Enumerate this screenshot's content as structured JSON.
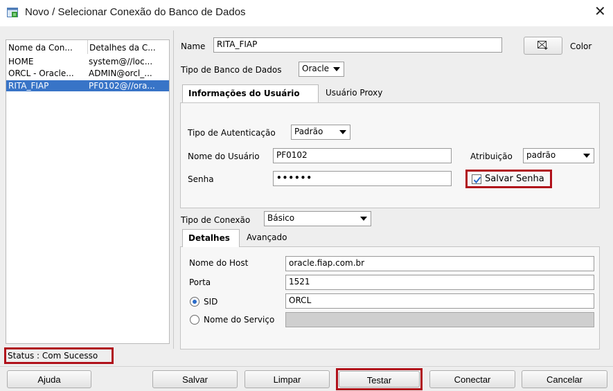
{
  "window": {
    "title": "Novo / Selecionar Conexão do Banco de Dados",
    "close_glyph": "✕"
  },
  "connections": {
    "columns": [
      "Nome da Con...",
      "Detalhes da C..."
    ],
    "rows": [
      {
        "name": "HOME",
        "details": "system@//loc...",
        "selected": false
      },
      {
        "name": "ORCL - Oracle...",
        "details": "ADMIN@orcl_...",
        "selected": false
      },
      {
        "name": "RITA_FIAP",
        "details": "PF0102@//ora...",
        "selected": true
      }
    ]
  },
  "form": {
    "name_label": "Name",
    "name_value": "RITA_FIAP",
    "color_label": "Color",
    "db_type_label": "Tipo de Banco de Dados",
    "db_type_value": "Oracle",
    "user_tabs": [
      "Informações do Usuário",
      "Usuário Proxy"
    ],
    "auth_type_label": "Tipo de Autenticação",
    "auth_type_value": "Padrão",
    "username_label": "Nome do Usuário",
    "username_value": "PF0102",
    "role_label": "Atribuição",
    "role_value": "padrão",
    "password_label": "Senha",
    "password_value": "••••••",
    "save_password_label": "Salvar Senha",
    "save_password_checked": true,
    "conn_type_label": "Tipo de Conexão",
    "conn_type_value": "Básico",
    "details_tabs": [
      "Detalhes",
      "Avançado"
    ],
    "host_label": "Nome do Host",
    "host_value": "oracle.fiap.com.br",
    "port_label": "Porta",
    "port_value": "1521",
    "sid_label": "SID",
    "sid_value": "ORCL",
    "service_label": "Nome do Serviço",
    "service_value": ""
  },
  "status": {
    "text": "Status : Com Sucesso"
  },
  "buttons": {
    "help": "Ajuda",
    "save": "Salvar",
    "clear": "Limpar",
    "test": "Testar",
    "connect": "Conectar",
    "cancel": "Cancelar"
  },
  "colors": {
    "selection": "#3874c7",
    "highlight_border": "#b0101a"
  }
}
